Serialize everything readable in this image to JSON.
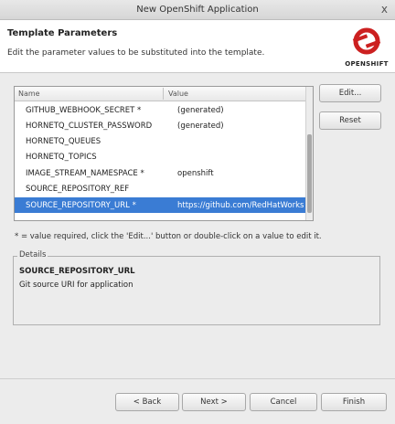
{
  "window": {
    "title": "New OpenShift Application",
    "close_glyph": "x"
  },
  "header": {
    "title": "Template Parameters",
    "description": "Edit the parameter values to be substituted into the template.",
    "logo_text": "OPENSHIFT"
  },
  "table": {
    "columns": {
      "name": "Name",
      "value": "Value"
    },
    "rows": [
      {
        "name": "GITHUB_WEBHOOK_SECRET *",
        "value": "(generated)"
      },
      {
        "name": "HORNETQ_CLUSTER_PASSWORD",
        "value": "(generated)"
      },
      {
        "name": "HORNETQ_QUEUES",
        "value": ""
      },
      {
        "name": "HORNETQ_TOPICS",
        "value": ""
      },
      {
        "name": "IMAGE_STREAM_NAMESPACE *",
        "value": "openshift"
      },
      {
        "name": "SOURCE_REPOSITORY_REF",
        "value": ""
      },
      {
        "name": "SOURCE_REPOSITORY_URL *",
        "value": "https://github.com/RedHatWorks"
      }
    ],
    "selected_index": 6
  },
  "side_buttons": {
    "edit": "Edit...",
    "reset": "Reset"
  },
  "hint": "* = value required, click the 'Edit...' button or double-click on a value to edit it.",
  "details": {
    "legend": "Details",
    "name": "SOURCE_REPOSITORY_URL",
    "description": "Git source URI for application"
  },
  "footer": {
    "back": "< Back",
    "next": "Next >",
    "cancel": "Cancel",
    "finish": "Finish"
  },
  "colors": {
    "selection": "#3a7cd4",
    "logo_red": "#cc2020"
  }
}
